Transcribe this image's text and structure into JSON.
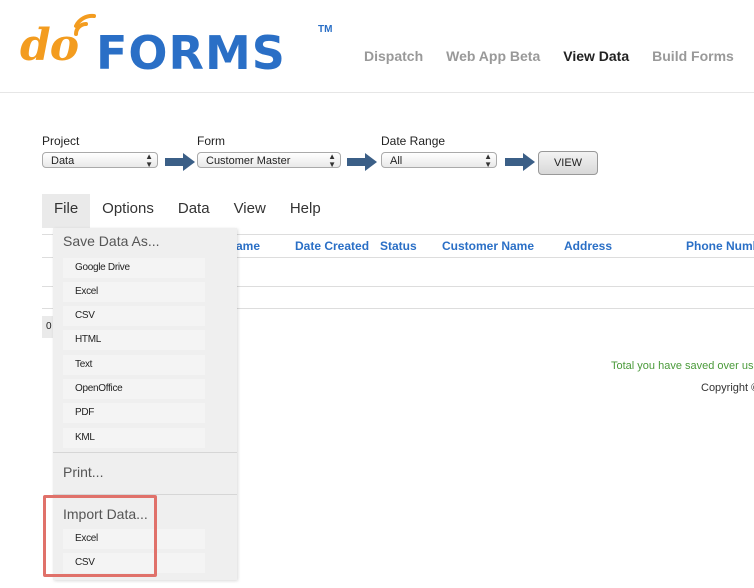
{
  "logo": {
    "part1": "do",
    "part2": "FORMS",
    "tm": "TM"
  },
  "topnav": [
    {
      "label": "Dispatch",
      "active": false
    },
    {
      "label": "Web App Beta",
      "active": false
    },
    {
      "label": "View Data",
      "active": true
    },
    {
      "label": "Build Forms",
      "active": false
    }
  ],
  "filters": {
    "project": {
      "label": "Project",
      "value": "Data"
    },
    "form": {
      "label": "Form",
      "value": "Customer Master"
    },
    "date_range": {
      "label": "Date Range",
      "value": "All"
    },
    "view_button": "VIEW"
  },
  "menubar": [
    "File",
    "Options",
    "Data",
    "View",
    "Help"
  ],
  "table": {
    "columns": [
      "ame",
      "Date Created",
      "Status",
      "Customer Name",
      "Address",
      "Phone Numb"
    ],
    "count": "0"
  },
  "footer": {
    "total_message": "Total you have saved over us",
    "copyright": "Copyright ©"
  },
  "file_menu": {
    "save_heading": "Save Data As...",
    "save_items": [
      "Google Drive",
      "Excel",
      "CSV",
      "HTML",
      "Text",
      "OpenOffice",
      "PDF",
      "KML"
    ],
    "print": "Print...",
    "import_heading": "Import Data...",
    "import_items": [
      "Excel",
      "CSV"
    ]
  },
  "colors": {
    "brand_orange": "#f39c1f",
    "brand_blue": "#2a6fc6",
    "arrow_blue": "#3b5f87",
    "highlight": "#e0716a"
  }
}
